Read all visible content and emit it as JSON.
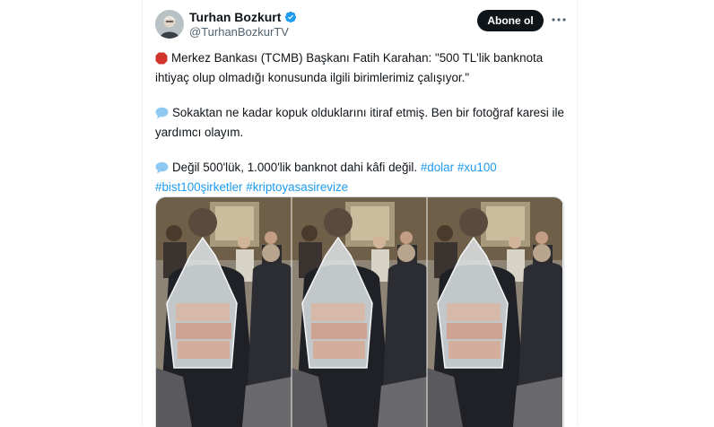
{
  "user": {
    "name": "Turhan Bozkurt",
    "handle": "@TurhanBozkurTV"
  },
  "actions": {
    "follow_label": "Abone ol"
  },
  "tweet": {
    "line1": "Merkez Bankası (TCMB) Başkanı Fatih Karahan: \"500 TL'lik banknota ihtiyaç olup olmadığı konusunda ilgili birimlerimiz çalışıyor.\"",
    "line2": "Sokaktan ne kadar kopuk olduklarını itiraf etmiş. Ben bir fotoğraf karesi ile yardımcı olayım.",
    "line3": "Değil 500'lük, 1.000'lik banknot dahi kâfi değil.",
    "hashtags": [
      "#dolar",
      "#xu100",
      "#bist100şirketler",
      "#kriptoyasasirevize"
    ]
  },
  "icons": {
    "verified": "verified-badge-icon",
    "more": "more-dots-icon",
    "stop": "red-stop-sign-icon",
    "speech": "speech-bubble-icon"
  },
  "colors": {
    "accent": "#1d9bf0",
    "text": "#0f1419",
    "secondary": "#536471",
    "button": "#0f1419"
  }
}
